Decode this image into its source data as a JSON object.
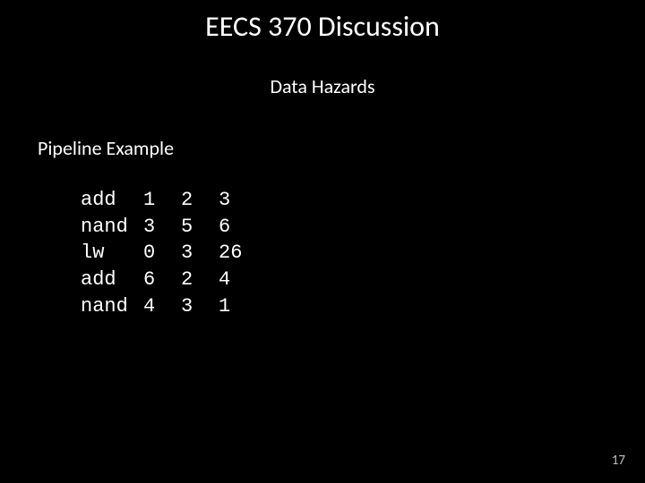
{
  "title": "EECS 370 Discussion",
  "subtitle": "Data Hazards",
  "section_heading": "Pipeline Example",
  "instructions": [
    {
      "op": "add",
      "a1": "1",
      "a2": "2",
      "a3": "3"
    },
    {
      "op": "nand",
      "a1": "3",
      "a2": "5",
      "a3": "6"
    },
    {
      "op": "lw",
      "a1": "0",
      "a2": "3",
      "a3": "26"
    },
    {
      "op": "add",
      "a1": "6",
      "a2": "2",
      "a3": "4"
    },
    {
      "op": "nand",
      "a1": "4",
      "a2": "3",
      "a3": "1"
    }
  ],
  "page_number": "17"
}
